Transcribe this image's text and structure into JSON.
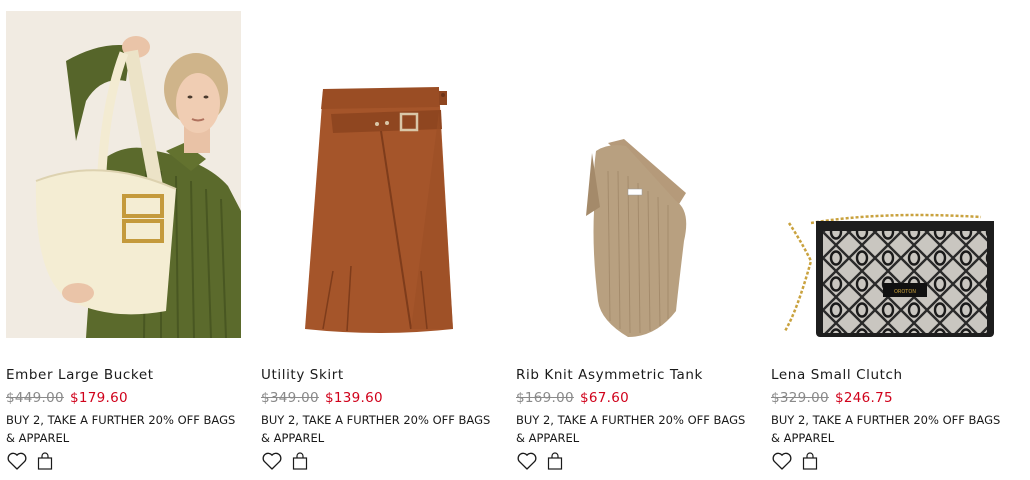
{
  "products": [
    {
      "name": "Ember Large Bucket",
      "original_price": "$449.00",
      "sale_price": "$179.60",
      "promo": "BUY 2, TAKE A FURTHER 20% OFF BAGS & APPAREL",
      "image": "ember-bucket-bag-photo"
    },
    {
      "name": "Utility Skirt",
      "original_price": "$349.00",
      "sale_price": "$139.60",
      "promo": "BUY 2, TAKE A FURTHER 20% OFF BAGS & APPAREL",
      "image": "utility-skirt-photo"
    },
    {
      "name": "Rib Knit Asymmetric Tank",
      "original_price": "$169.00",
      "sale_price": "$67.60",
      "promo": "BUY 2, TAKE A FURTHER 20% OFF BAGS & APPAREL",
      "image": "rib-knit-tank-photo"
    },
    {
      "name": "Lena Small Clutch",
      "original_price": "$329.00",
      "sale_price": "$246.75",
      "promo": "BUY 2, TAKE A FURTHER 20% OFF BAGS & APPAREL",
      "image": "lena-clutch-photo",
      "logo_text": "OROTON"
    }
  ],
  "icons": {
    "wishlist": "heart-icon",
    "add_to_bag": "shopping-bag-icon"
  },
  "colors": {
    "sale": "#d0021b",
    "original": "#8a8a8a",
    "text": "#1a1a1a"
  }
}
